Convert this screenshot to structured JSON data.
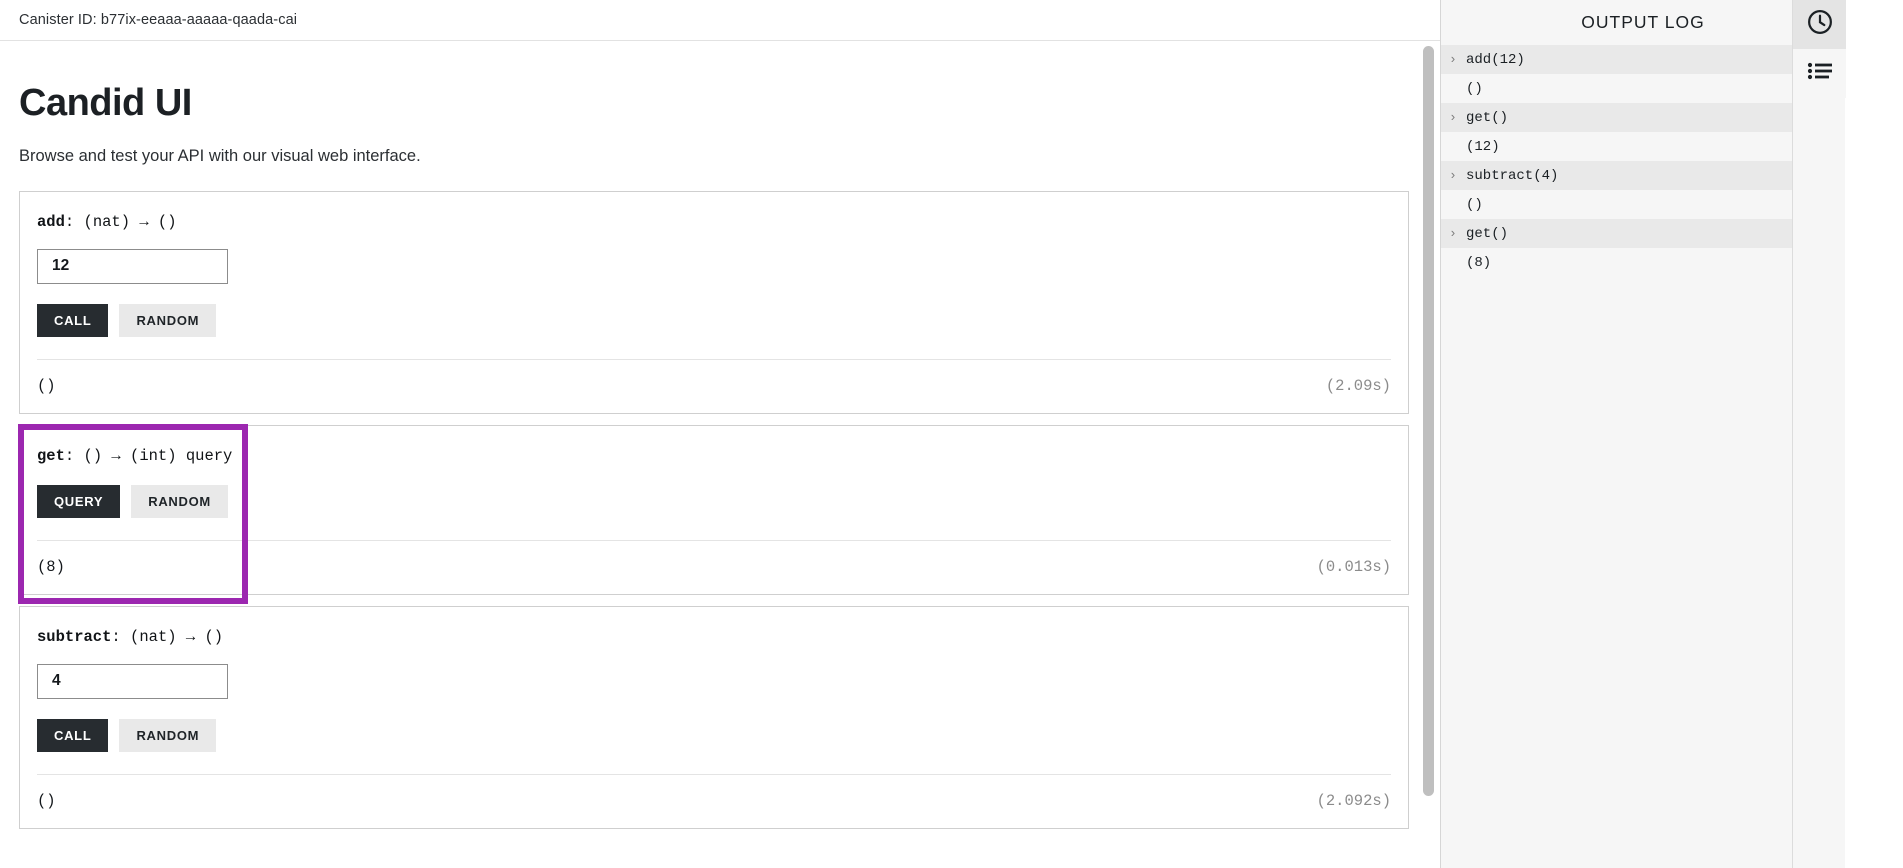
{
  "canister": {
    "label": "Canister ID: b77ix-eeaaa-aaaaa-qaada-cai"
  },
  "header": {
    "title": "Candid UI",
    "subtitle": "Browse and test your API with our visual web interface."
  },
  "methods": [
    {
      "name": "add",
      "colon": ":",
      "signature": " (nat) → ()",
      "has_input": true,
      "input_value": "12",
      "input_placeholder": "",
      "primary_label": "CALL",
      "secondary_label": "RANDOM",
      "result": "()",
      "duration": "(2.09s)",
      "highlighted": false
    },
    {
      "name": "get",
      "colon": ":",
      "signature": " () → (int) query",
      "has_input": false,
      "input_value": "",
      "input_placeholder": "",
      "primary_label": "QUERY",
      "secondary_label": "RANDOM",
      "result": "(8)",
      "duration": "(0.013s)",
      "highlighted": true
    },
    {
      "name": "subtract",
      "colon": ":",
      "signature": " (nat) → ()",
      "has_input": true,
      "input_value": "4",
      "input_placeholder": "",
      "primary_label": "CALL",
      "secondary_label": "RANDOM",
      "result": "()",
      "duration": "(2.092s)",
      "highlighted": false
    }
  ],
  "output_log": {
    "title": "OUTPUT LOG",
    "chevron": "›",
    "entries": [
      {
        "kind": "call",
        "text": "add(12)"
      },
      {
        "kind": "result",
        "text": "()"
      },
      {
        "kind": "call",
        "text": "get()"
      },
      {
        "kind": "result",
        "text": "(12)"
      },
      {
        "kind": "call",
        "text": "subtract(4)"
      },
      {
        "kind": "result",
        "text": "()"
      },
      {
        "kind": "call",
        "text": "get()"
      },
      {
        "kind": "result",
        "text": "(8)"
      }
    ]
  },
  "icon_rail": [
    {
      "icon": "clock-icon",
      "active": true
    },
    {
      "icon": "list-icon",
      "active": false
    }
  ],
  "colors": {
    "highlight": "#9c27b0",
    "button_primary_bg": "#272c30",
    "button_secondary_bg": "#e9e9e9",
    "log_call_bg": "#e9e9e9",
    "log_result_bg": "#f6f6f6"
  }
}
